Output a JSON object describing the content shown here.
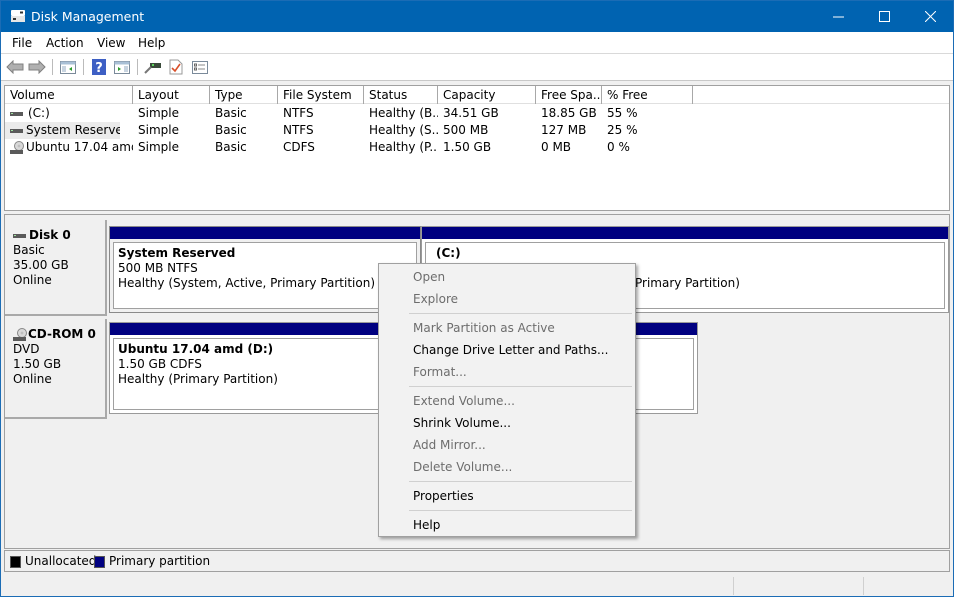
{
  "window": {
    "title": "Disk Management",
    "controls": [
      "minimize",
      "maximize",
      "close"
    ]
  },
  "menu": [
    "File",
    "Action",
    "View",
    "Help"
  ],
  "toolbar": {
    "buttons": [
      "back-icon",
      "forward-icon",
      "show-hide-console-tree-icon",
      "help-icon",
      "show-hide-action-pane-icon",
      "connect-disk-icon",
      "checklist-icon",
      "properties-list-icon"
    ]
  },
  "volume_list": {
    "columns": [
      "Volume",
      "Layout",
      "Type",
      "File System",
      "Status",
      "Capacity",
      "Free Spa...",
      "% Free"
    ],
    "rows": [
      {
        "icon": "drive-icon",
        "volume": "(C:)",
        "layout": "Simple",
        "type": "Basic",
        "fs": "NTFS",
        "status": "Healthy (B...",
        "capacity": "34.51 GB",
        "free": "18.85 GB",
        "pct": "55 %"
      },
      {
        "icon": "drive-icon",
        "volume": "System Reserved",
        "layout": "Simple",
        "type": "Basic",
        "fs": "NTFS",
        "status": "Healthy (S...",
        "capacity": "500 MB",
        "free": "127 MB",
        "pct": "25 %"
      },
      {
        "icon": "cd-drive-icon",
        "volume": "Ubuntu 17.04 amd...",
        "layout": "Simple",
        "type": "Basic",
        "fs": "CDFS",
        "status": "Healthy (P...",
        "capacity": "1.50 GB",
        "free": "0 MB",
        "pct": "0 %"
      }
    ]
  },
  "disks": [
    {
      "name": "Disk 0",
      "kind": "Basic",
      "size": "35.00 GB",
      "state": "Online",
      "partitions": [
        {
          "name": "System Reserved",
          "detail": "500 MB NTFS",
          "status": "Healthy (System, Active, Primary Partition)",
          "selected": true
        },
        {
          "name": "(C:)",
          "detail": "",
          "status": "Primary Partition)",
          "selected": false
        }
      ]
    },
    {
      "name": "CD-ROM 0",
      "kind": "DVD",
      "size": "1.50 GB",
      "state": "Online",
      "partitions": [
        {
          "name": "Ubuntu 17.04 amd  (D:)",
          "detail": "1.50 GB CDFS",
          "status": "Healthy (Primary Partition)",
          "selected": false
        }
      ]
    }
  ],
  "legend": [
    {
      "label": "Unallocated",
      "color": "#000000"
    },
    {
      "label": "Primary partition",
      "color": "#000080"
    }
  ],
  "context_menu": {
    "items": [
      {
        "label": "Open",
        "enabled": false
      },
      {
        "label": "Explore",
        "enabled": false
      },
      {
        "label": "Mark Partition as Active",
        "enabled": false
      },
      {
        "label": "Change Drive Letter and Paths...",
        "enabled": true
      },
      {
        "label": "Format...",
        "enabled": false
      },
      {
        "label": "Extend Volume...",
        "enabled": false
      },
      {
        "label": "Shrink Volume...",
        "enabled": true
      },
      {
        "label": "Add Mirror...",
        "enabled": false
      },
      {
        "label": "Delete Volume...",
        "enabled": false
      },
      {
        "label": "Properties",
        "enabled": true
      },
      {
        "label": "Help",
        "enabled": true
      }
    ]
  },
  "colors": {
    "titlebar": "#0063b1",
    "partition_bar": "#000080"
  }
}
